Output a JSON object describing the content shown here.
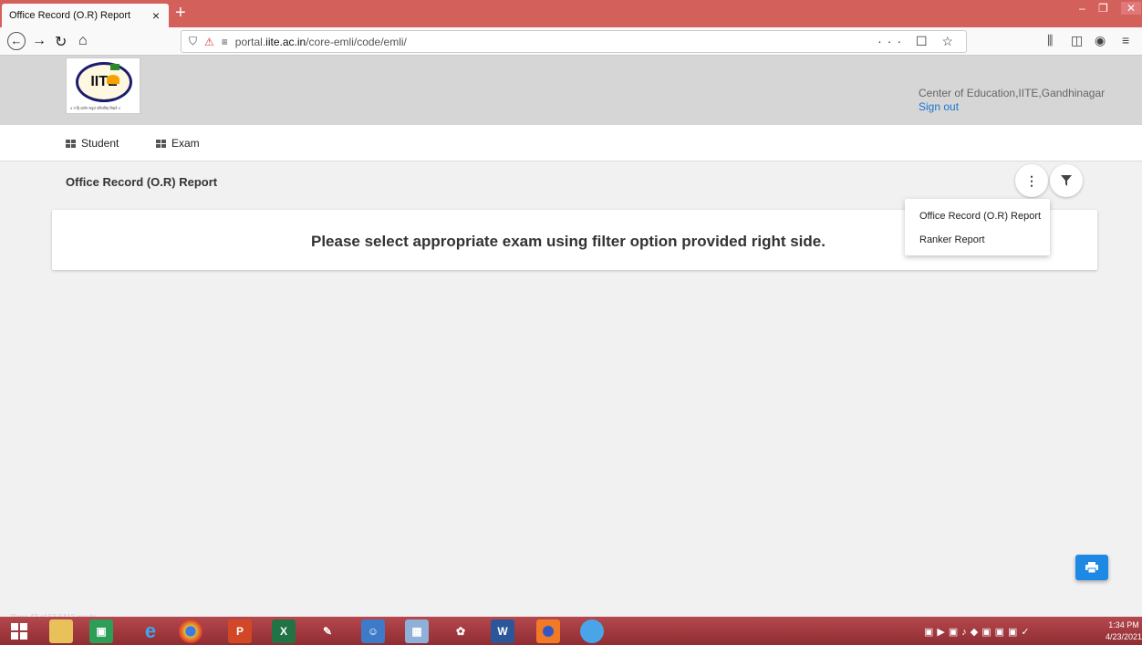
{
  "browser": {
    "tab_title": "Office Record (O.R) Report",
    "tab_close": "×",
    "new_tab": "+",
    "url_prefix": "portal.",
    "url_domain": "iite.ac.in",
    "url_path": "/core-emli/code/emli/",
    "url_actions": "··· ☐ ☆"
  },
  "header": {
    "org_name": "Center of Education,IITE,Gandhinagar",
    "signout_label": "Sign out",
    "logo_text": "IITE",
    "logo_caption": "॥ न हि ज्ञानेन सदृशं पवित्रमिह विद्यते ॥"
  },
  "menu": {
    "items": [
      {
        "label": "Student"
      },
      {
        "label": "Exam"
      }
    ]
  },
  "page": {
    "title": "Office Record (O.R) Report",
    "message": "Please select appropriate exam using filter option provided right side."
  },
  "dropdown": {
    "items": [
      {
        "label": "Office Record (O.R) Report"
      },
      {
        "label": "Ranker Report"
      }
    ]
  },
  "taskbar": {
    "time": "1:34 PM",
    "date": "4/23/2021",
    "status_ghost": "Page 43 of 53   5412 words"
  },
  "colors": {
    "tabbar": "#d4605c",
    "header_bg": "#d6d6d6",
    "link": "#1976d2",
    "print_button": "#1e88e5"
  }
}
